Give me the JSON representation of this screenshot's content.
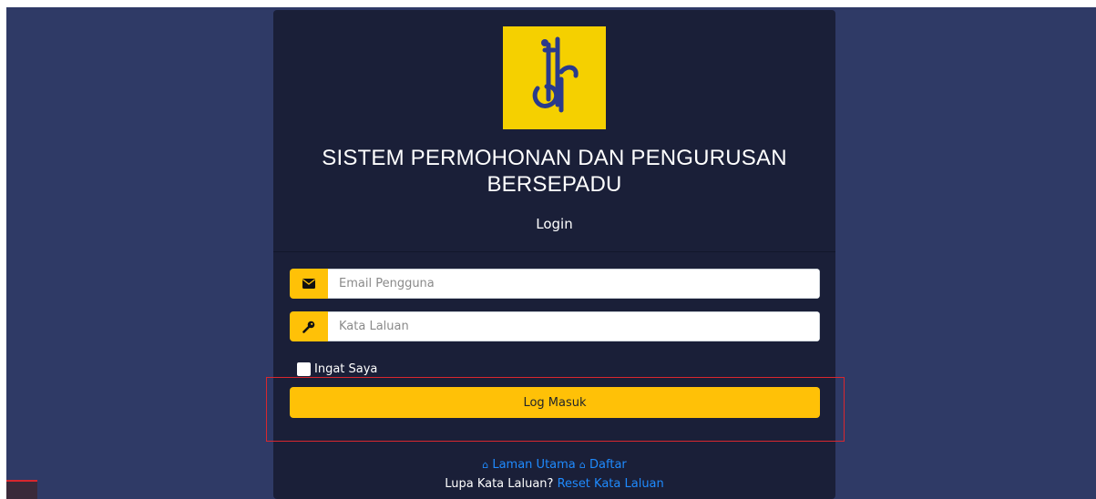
{
  "app": {
    "title": "SISTEM PERMOHONAN DAN PENGURUSAN BERSEPADU",
    "subtitle": "Login"
  },
  "form": {
    "email_placeholder": "Email Pengguna",
    "password_placeholder": "Kata Laluan",
    "remember_label": "Ingat Saya",
    "submit_label": "Log Masuk"
  },
  "links": {
    "home_label": "Laman Utama",
    "register_label": "Daftar",
    "forgot_text": "Lupa Kata Laluan?",
    "reset_label": "Reset Kata Laluan"
  },
  "icons": {
    "email": "envelope-icon",
    "password": "key-icon",
    "home": "home-icon"
  },
  "colors": {
    "background": "#2f3a66",
    "card": "#1a1f38",
    "accent": "#ffc107",
    "logo": "#f5d000",
    "link": "#1f8bff",
    "highlight": "#d9272e"
  }
}
